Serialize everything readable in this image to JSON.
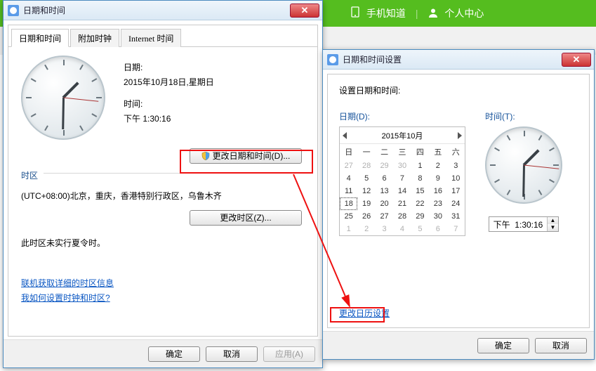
{
  "header": {
    "mobile_label": "手机知道",
    "personal_label": "个人中心"
  },
  "win1": {
    "title": "日期和时间",
    "tabs": [
      "日期和时间",
      "附加时钟",
      "Internet 时间"
    ],
    "date_label": "日期:",
    "date_value": "2015年10月18日,星期日",
    "time_label": "时间:",
    "time_value": "下午 1:30:16",
    "change_dt_btn": "更改日期和时间(D)...",
    "tz_heading": "时区",
    "tz_value": "(UTC+08:00)北京，重庆，香港特别行政区，乌鲁木齐",
    "change_tz_btn": "更改时区(Z)...",
    "dst_note": "此时区未实行夏令时。",
    "link1": "联机获取详细的时区信息",
    "link2": "我如何设置时钟和时区?",
    "ok": "确定",
    "cancel": "取消",
    "apply": "应用(A)"
  },
  "win2": {
    "title": "日期和时间设置",
    "set_label": "设置日期和时间:",
    "date_heading": "日期(D):",
    "time_heading": "时间(T):",
    "month_title": "2015年10月",
    "dow": [
      "日",
      "一",
      "二",
      "三",
      "四",
      "五",
      "六"
    ],
    "grid": [
      {
        "v": "27",
        "m": true
      },
      {
        "v": "28",
        "m": true
      },
      {
        "v": "29",
        "m": true
      },
      {
        "v": "30",
        "m": true
      },
      {
        "v": "1"
      },
      {
        "v": "2"
      },
      {
        "v": "3"
      },
      {
        "v": "4"
      },
      {
        "v": "5"
      },
      {
        "v": "6"
      },
      {
        "v": "7"
      },
      {
        "v": "8"
      },
      {
        "v": "9"
      },
      {
        "v": "10"
      },
      {
        "v": "11"
      },
      {
        "v": "12"
      },
      {
        "v": "13"
      },
      {
        "v": "14"
      },
      {
        "v": "15"
      },
      {
        "v": "16"
      },
      {
        "v": "17"
      },
      {
        "v": "18",
        "sel": true
      },
      {
        "v": "19"
      },
      {
        "v": "20"
      },
      {
        "v": "21"
      },
      {
        "v": "22"
      },
      {
        "v": "23"
      },
      {
        "v": "24"
      },
      {
        "v": "25"
      },
      {
        "v": "26"
      },
      {
        "v": "27"
      },
      {
        "v": "28"
      },
      {
        "v": "29"
      },
      {
        "v": "30"
      },
      {
        "v": "31"
      },
      {
        "v": "1",
        "m": true
      },
      {
        "v": "2",
        "m": true
      },
      {
        "v": "3",
        "m": true
      },
      {
        "v": "4",
        "m": true
      },
      {
        "v": "5",
        "m": true
      },
      {
        "v": "6",
        "m": true
      },
      {
        "v": "7",
        "m": true
      }
    ],
    "time_value": "下午  1:30:16",
    "change_cal": "更改日历设置",
    "ok": "确定",
    "cancel": "取消"
  }
}
